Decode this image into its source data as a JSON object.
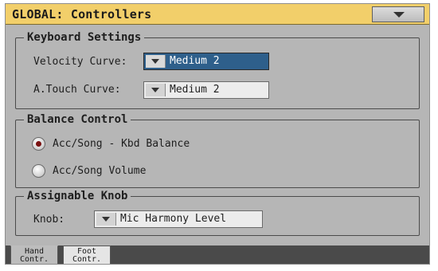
{
  "header": {
    "title": "GLOBAL: Controllers",
    "menu_icon": "chevron-down-icon"
  },
  "keyboard_settings": {
    "title": "Keyboard Settings",
    "velocity_curve": {
      "label": "Velocity Curve:",
      "value": "Medium 2"
    },
    "atouch_curve": {
      "label": "A.Touch Curve:",
      "value": "Medium 2"
    }
  },
  "balance_control": {
    "title": "Balance Control",
    "options": [
      {
        "label": "Acc/Song - Kbd Balance",
        "selected": true
      },
      {
        "label": "Acc/Song Volume",
        "selected": false
      }
    ]
  },
  "assignable_knob": {
    "title": "Assignable Knob",
    "knob": {
      "label": "Knob:",
      "value": "Mic Harmony Level"
    }
  },
  "tabs": [
    {
      "line1": "Hand",
      "line2": "Contr.",
      "active": true
    },
    {
      "line1": "Foot",
      "line2": "Contr.",
      "active": false
    }
  ],
  "colors": {
    "title_bar": "#f2cf6a",
    "panel": "#b6b6b6",
    "selected_field": "#2e5f8b",
    "radio_selected": "#7a1212"
  }
}
